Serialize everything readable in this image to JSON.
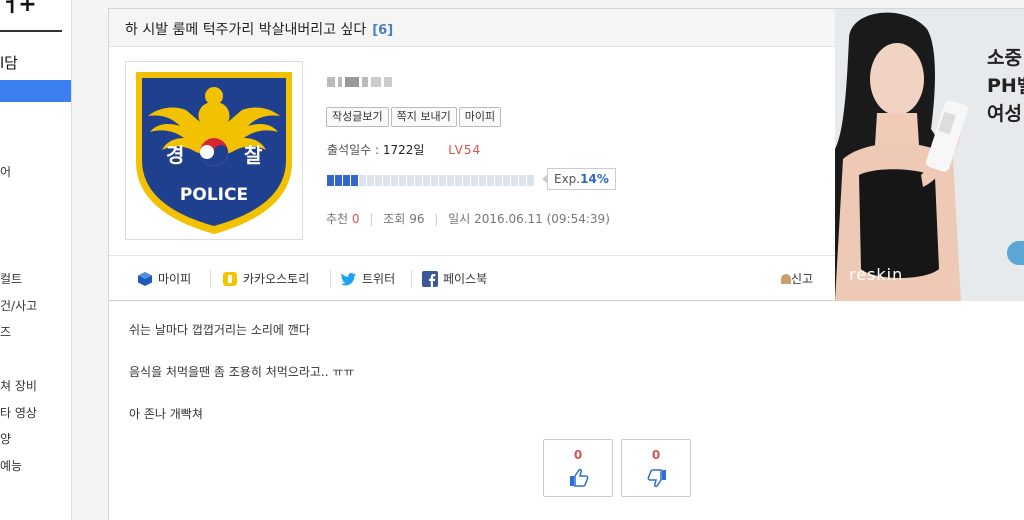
{
  "sidebar": {
    "logo": "ㅓ+",
    "title": "l담",
    "items": [
      "어",
      "컬트",
      "건/사고",
      "즈",
      "쳐 장비",
      "타 영상",
      "양",
      "예능"
    ]
  },
  "post": {
    "title": "하 시발 룸메 턱주가리 박살내버리고 싶다",
    "comment_count": "[6]",
    "body": [
      "쉬는 날마다 껍껍거리는 소리에 깬다",
      "음식을 처먹을땐 좀 조용히 처먹으라고.. ㅠㅠ",
      "아 존나 개빡쳐"
    ]
  },
  "profile": {
    "avatar_text_left": "경",
    "avatar_text_right": "찰",
    "avatar_text_bottom": "POLICE",
    "buttons": [
      "작성글보기",
      "쪽지 보내기",
      "마이피"
    ],
    "attendance_label": "출석일수 :",
    "attendance_value": "1722일",
    "level": "LV54",
    "exp_label": "Exp.",
    "exp_percent": "14%",
    "exp_fraction": 0.14
  },
  "stats": {
    "recommend_label": "추천",
    "recommend_value": "0",
    "views_label": "조회",
    "views_value": "96",
    "date_label": "일시",
    "date_value": "2016.06.11 (09:54:39)"
  },
  "share": {
    "items": [
      "마이피",
      "카카오스토리",
      "트위터",
      "페이스북"
    ],
    "report": "신고"
  },
  "ad": {
    "lines": [
      "소중",
      "PH밸",
      "여성"
    ],
    "brand": "reskin"
  },
  "votes": {
    "up": "0",
    "down": "0"
  },
  "colors": {
    "accent": "#3b7ff0",
    "level": "#d9534f",
    "exp": "#3366cc",
    "police_blue": "#1f3f8f",
    "police_gold": "#f2c200"
  }
}
